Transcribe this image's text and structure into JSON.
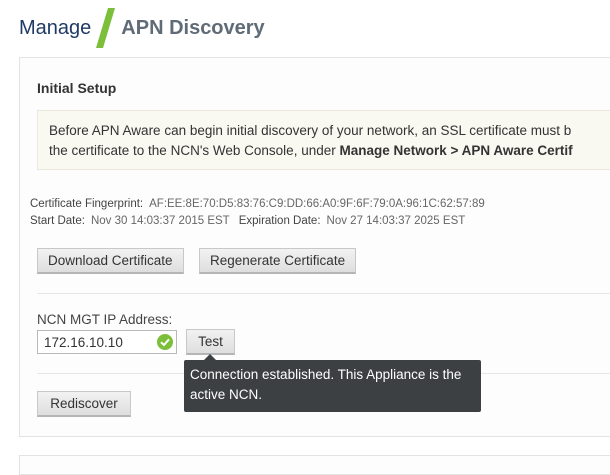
{
  "breadcrumb": {
    "parent": "Manage",
    "title": "APN Discovery"
  },
  "colors": {
    "brand_navy": "#1f3a66",
    "slash_green": "#7cbf3a",
    "success_green": "#7cbf3a",
    "tooltip_bg": "#3c4043"
  },
  "initial_setup": {
    "title": "Initial Setup",
    "notice_line1": "Before APN Aware can begin initial discovery of your network, an SSL certificate must b",
    "notice_line2_prefix": "the certificate to the NCN's Web Console, under ",
    "notice_line2_bold": "Manage Network > APN Aware Certif"
  },
  "certificate": {
    "fingerprint_label": "Certificate Fingerprint:",
    "fingerprint_value": "AF:EE:8E:70:D5:83:76:C9:DD:66:A0:9F:6F:79:0A:96:1C:62:57:89",
    "start_label": "Start Date:",
    "start_value": "Nov 30 14:03:37 2015 EST",
    "expiration_label": "Expiration Date:",
    "expiration_value": "Nov 27 14:03:37 2025 EST",
    "download_label": "Download Certificate",
    "regenerate_label": "Regenerate Certificate"
  },
  "ncn": {
    "ip_label": "NCN MGT IP Address:",
    "ip_value": "172.16.10.10",
    "status_icon": "check-circle-icon",
    "test_label": "Test",
    "tooltip": "Connection established. This Appliance is the active NCN."
  },
  "actions": {
    "rediscover_label": "Rediscover"
  }
}
